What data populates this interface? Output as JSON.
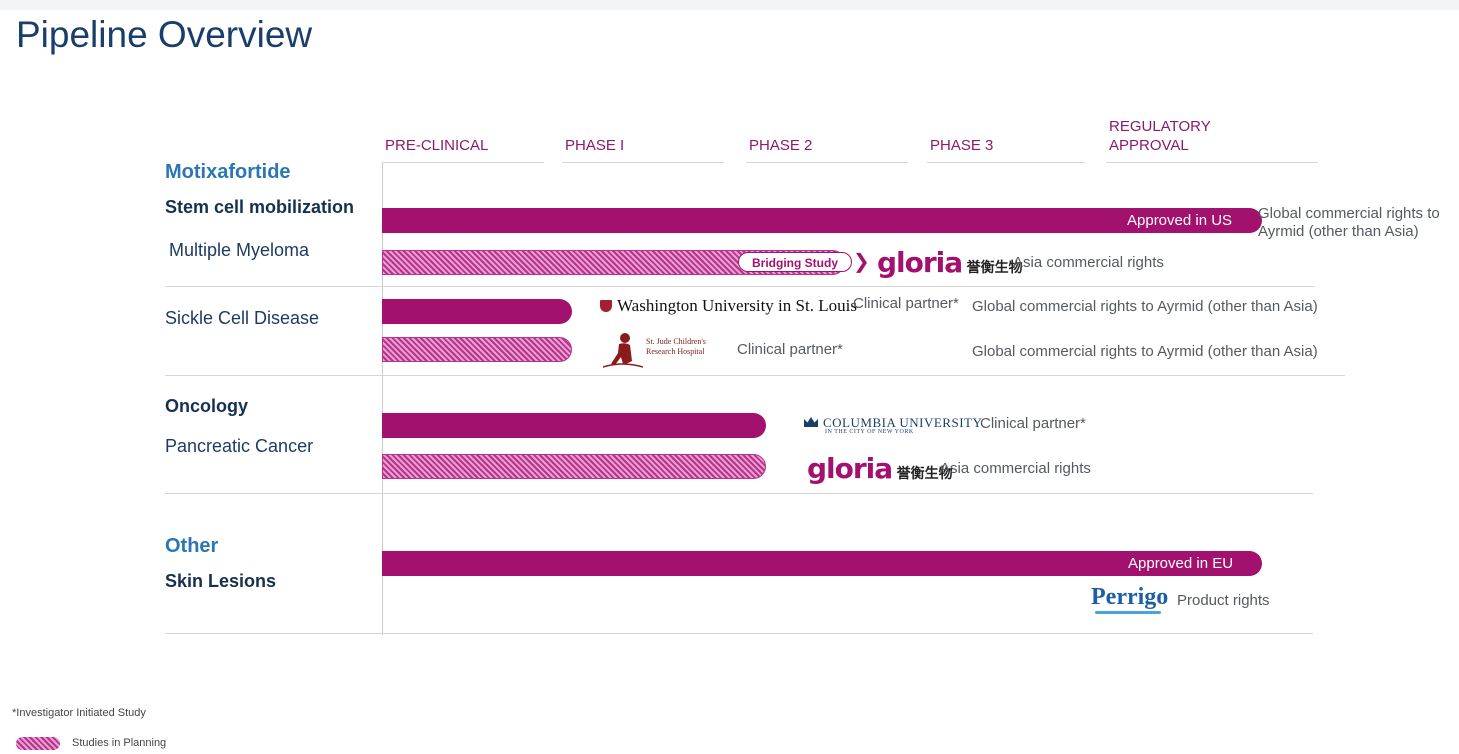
{
  "title": "Pipeline Overview",
  "chart_data": {
    "type": "bar",
    "orientation": "horizontal",
    "phases": [
      "PRE-CLINICAL",
      "PHASE I",
      "PHASE 2",
      "PHASE 3",
      "REGULATORY\nAPPROVAL"
    ],
    "drug": "Motixafortide",
    "programs": [
      {
        "category": "",
        "indication": "Stem cell mobilization",
        "sub_indication": "Multiple Myeloma",
        "bars": [
          {
            "type": "solid",
            "end_phase": 5.0,
            "label": "Approved in US",
            "note": "Global  commercial rights to\nAyrmid (other than Asia)"
          },
          {
            "type": "planning",
            "end_phase": 2.63,
            "pill": "Bridging Study",
            "partner_logo": "gloria-logo",
            "note": "Asia commercial rights"
          }
        ]
      },
      {
        "category": "",
        "indication": "Sickle Cell Disease",
        "bars": [
          {
            "type": "solid",
            "end_phase": 1.08,
            "partner_logo": "washington-university-logo",
            "partner_note": "Clinical partner*",
            "note": "Global  commercial rights to Ayrmid (other than Asia)"
          },
          {
            "type": "planning",
            "end_phase": 1.08,
            "partner_logo": "st-jude-logo",
            "partner_note": "Clinical partner*",
            "note": "Global  commercial rights to Ayrmid (other than Asia)"
          }
        ]
      },
      {
        "category": "Oncology",
        "indication": "Pancreatic Cancer",
        "bars": [
          {
            "type": "solid",
            "end_phase": 2.18,
            "partner_logo": "columbia-university-logo",
            "partner_note": "Clinical partner*"
          },
          {
            "type": "planning",
            "end_phase": 2.18,
            "partner_logo": "gloria-logo",
            "note": "Asia commercial rights"
          }
        ]
      },
      {
        "category": "Other",
        "indication": "Skin Lesions",
        "bars": [
          {
            "type": "solid",
            "end_phase": 5.0,
            "label": "Approved in EU",
            "partner_logo": "perrigo-logo",
            "note": "Product rights"
          }
        ]
      }
    ],
    "legend": [
      {
        "swatch": "hatched",
        "label": "Studies in Planning"
      }
    ],
    "footnote": "*Investigator Initiated Study"
  },
  "logos": {
    "gloria": {
      "word": "gloria",
      "cn": "誉衡生物"
    },
    "washington": {
      "text": "Washington University in St. Louis"
    },
    "stjude": {
      "line1": "St. Jude Children's",
      "line2": "Research Hospital"
    },
    "columbia": {
      "main": "COLUMBIA UNIVERSITY",
      "sub": "IN THE CITY OF NEW YORK"
    },
    "perrigo": {
      "text": "Perrigo"
    }
  },
  "colors": {
    "bar": "#a3116e",
    "planning_light": "#e7a0cf",
    "category": "#2b77b5",
    "phase": "#8a1a6b"
  }
}
